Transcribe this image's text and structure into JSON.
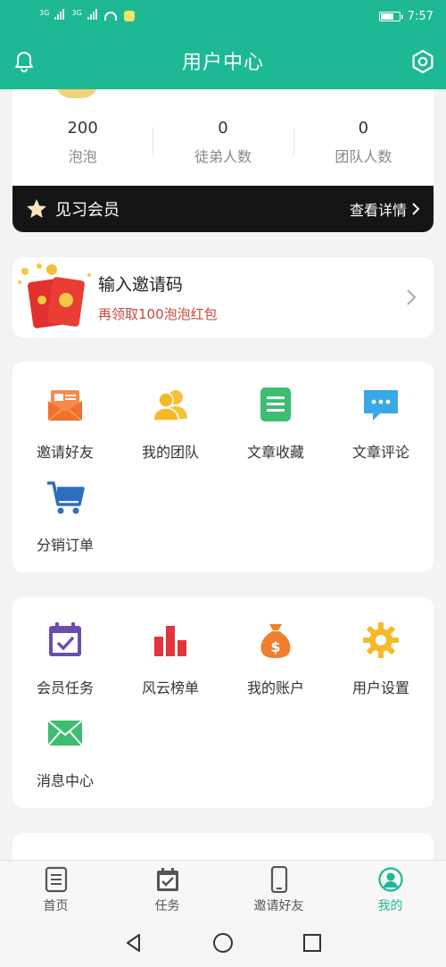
{
  "status_bar": {
    "sim1_label": "3G",
    "sim2_label": "3G",
    "time": "7:57"
  },
  "header": {
    "title": "用户中心"
  },
  "profile": {
    "stats": [
      {
        "value": "200",
        "label": "泡泡"
      },
      {
        "value": "0",
        "label": "徒弟人数"
      },
      {
        "value": "0",
        "label": "团队人数"
      }
    ],
    "membership": {
      "level": "见习会员",
      "detail_link": "查看详情"
    }
  },
  "invite_code": {
    "title": "输入邀请码",
    "subtitle": "再领取100泡泡红包"
  },
  "feature_group_1": {
    "items": [
      {
        "label": "邀请好友",
        "icon": "invite-mail-icon",
        "color": "#f0702e"
      },
      {
        "label": "我的团队",
        "icon": "team-icon",
        "color": "#f5b92a"
      },
      {
        "label": "文章收藏",
        "icon": "article-favorite-icon",
        "color": "#3dbd72"
      },
      {
        "label": "文章评论",
        "icon": "comment-icon",
        "color": "#3aa7e8"
      },
      {
        "label": "分销订单",
        "icon": "cart-icon",
        "color": "#2c6fbd"
      }
    ]
  },
  "feature_group_2": {
    "items": [
      {
        "label": "会员任务",
        "icon": "calendar-check-icon",
        "color": "#6b4db0"
      },
      {
        "label": "风云榜单",
        "icon": "bar-chart-icon",
        "color": "#e0353a"
      },
      {
        "label": "我的账户",
        "icon": "money-bag-icon",
        "color": "#f07e2c"
      },
      {
        "label": "用户设置",
        "icon": "gear-icon",
        "color": "#f5b92a"
      },
      {
        "label": "消息中心",
        "icon": "envelope-icon",
        "color": "#3dbd72"
      }
    ]
  },
  "tabbar": {
    "tabs": [
      {
        "label": "首页",
        "icon": "home-doc-icon",
        "active": false
      },
      {
        "label": "任务",
        "icon": "task-calendar-icon",
        "active": false
      },
      {
        "label": "邀请好友",
        "icon": "phone-icon",
        "active": false
      },
      {
        "label": "我的",
        "icon": "profile-icon",
        "active": true
      }
    ]
  },
  "colors": {
    "brand": "#1db894",
    "member_bar": "#151515",
    "invite_sub": "#c8473f",
    "page_bg": "#f1f3f5"
  }
}
